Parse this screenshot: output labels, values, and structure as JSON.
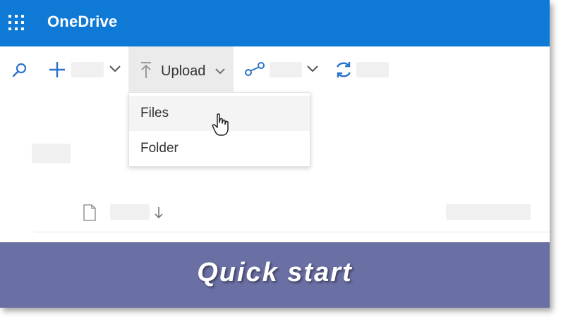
{
  "app": {
    "title": "OneDrive",
    "brand_color": "#0f7ad6"
  },
  "toolbar": {
    "upload_label": "Upload"
  },
  "upload_menu": {
    "items": [
      {
        "label": "Files"
      },
      {
        "label": "Folder"
      }
    ]
  },
  "banner": {
    "text": "Quick start",
    "color": "#6a6fa4"
  },
  "icons": {
    "launcher": "waffle-icon",
    "search": "search-icon",
    "new": "plus-icon",
    "upload": "upload-arrow-icon",
    "share": "share-icon",
    "sync": "sync-icon",
    "file": "file-icon",
    "sort": "sort-arrow-icon",
    "pointer": "hand-cursor-icon"
  }
}
